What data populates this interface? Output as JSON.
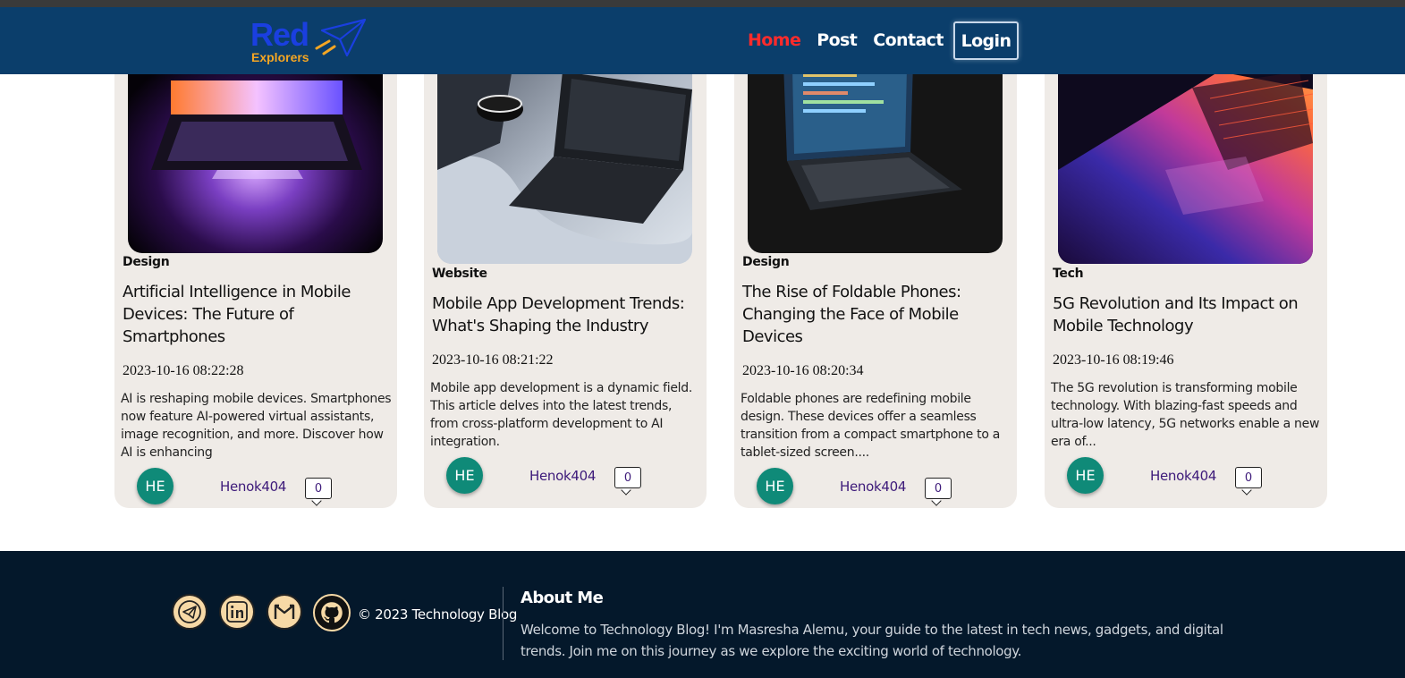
{
  "header": {
    "logo_main": "Red",
    "logo_sub": "Explorers",
    "nav": [
      {
        "label": "Home",
        "active": true
      },
      {
        "label": "Post",
        "active": false
      },
      {
        "label": "Contact",
        "active": false
      }
    ],
    "login_label": "Login"
  },
  "cards": [
    {
      "category": "Design",
      "title": "Artificial Intelligence in Mobile Devices: The Future of Smartphones",
      "date": "2023-10-16 08:22:28",
      "excerpt": "AI is reshaping mobile devices. Smartphones now feature AI-powered virtual assistants, image recognition, and more. Discover how AI is enhancing",
      "avatar": "HE",
      "author": "Henok404",
      "comments": "0"
    },
    {
      "category": "Website",
      "title": "Mobile App Development Trends: What's Shaping the Industry",
      "date": "2023-10-16 08:21:22",
      "excerpt": "Mobile app development is a dynamic field. This article delves into the latest trends, from cross-platform development to AI integration.",
      "avatar": "HE",
      "author": "Henok404",
      "comments": "0"
    },
    {
      "category": "Design",
      "title": "The Rise of Foldable Phones: Changing the Face of Mobile Devices",
      "date": "2023-10-16 08:20:34",
      "excerpt": "Foldable phones are redefining mobile design. These devices offer a seamless transition from a compact smartphone to a tablet-sized screen....",
      "avatar": "HE",
      "author": "Henok404",
      "comments": "0"
    },
    {
      "category": "Tech",
      "title": "5G Revolution and Its Impact on Mobile Technology",
      "date": "2023-10-16 08:19:46",
      "excerpt": "The 5G revolution is transforming mobile technology. With blazing-fast speeds and ultra-low latency, 5G networks enable a new era of...",
      "avatar": "HE",
      "author": "Henok404",
      "comments": "0"
    }
  ],
  "footer": {
    "social_icons": [
      "telegram-icon",
      "linkedin-icon",
      "gmail-icon",
      "github-icon"
    ],
    "copyright": "© 2023 Technology Blog",
    "about_title": "About Me",
    "about_text": "Welcome to Technology Blog! I'm Masresha Alemu, your guide to the latest in tech news, gadgets, and digital trends. Join me on this journey as we explore the exciting world of technology."
  },
  "colors": {
    "navbar": "#0b3e6b",
    "nav_active": "#ff2b2b",
    "card_bg": "#efebe7",
    "avatar": "#0f8a78",
    "author": "#3d1a7a",
    "footer": "#04182b"
  }
}
